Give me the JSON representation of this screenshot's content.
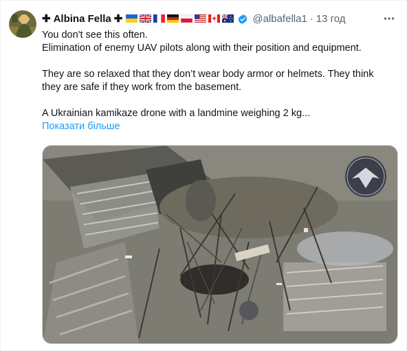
{
  "tweet": {
    "author_name": "Albina Fella",
    "cross_symbol": "✚",
    "flags": [
      "ukraine-flag",
      "uk-flag",
      "france-flag",
      "germany-flag",
      "poland-flag",
      "usa-flag",
      "canada-flag",
      "australia-flag"
    ],
    "handle": "@albafella1",
    "separator": "·",
    "time": "13 год",
    "lines": [
      "You don't see this often.",
      "Elimination of enemy UAV pilots along with their position and equipment.",
      "They are so relaxed that they don’t wear body armor or helmets. They think",
      "they are safe if they work from the basement.",
      "A Ukrainian kamikaze drone with a landmine weighing 2 kg..."
    ],
    "show_more": "Показати більше",
    "media_icon": "drone-unit-emblem",
    "verified_icon": "verified-badge-icon"
  },
  "colors": {
    "text": "#0f1419",
    "secondary": "#536471",
    "link": "#1d9bf0",
    "verified": "#1d9bf0"
  }
}
